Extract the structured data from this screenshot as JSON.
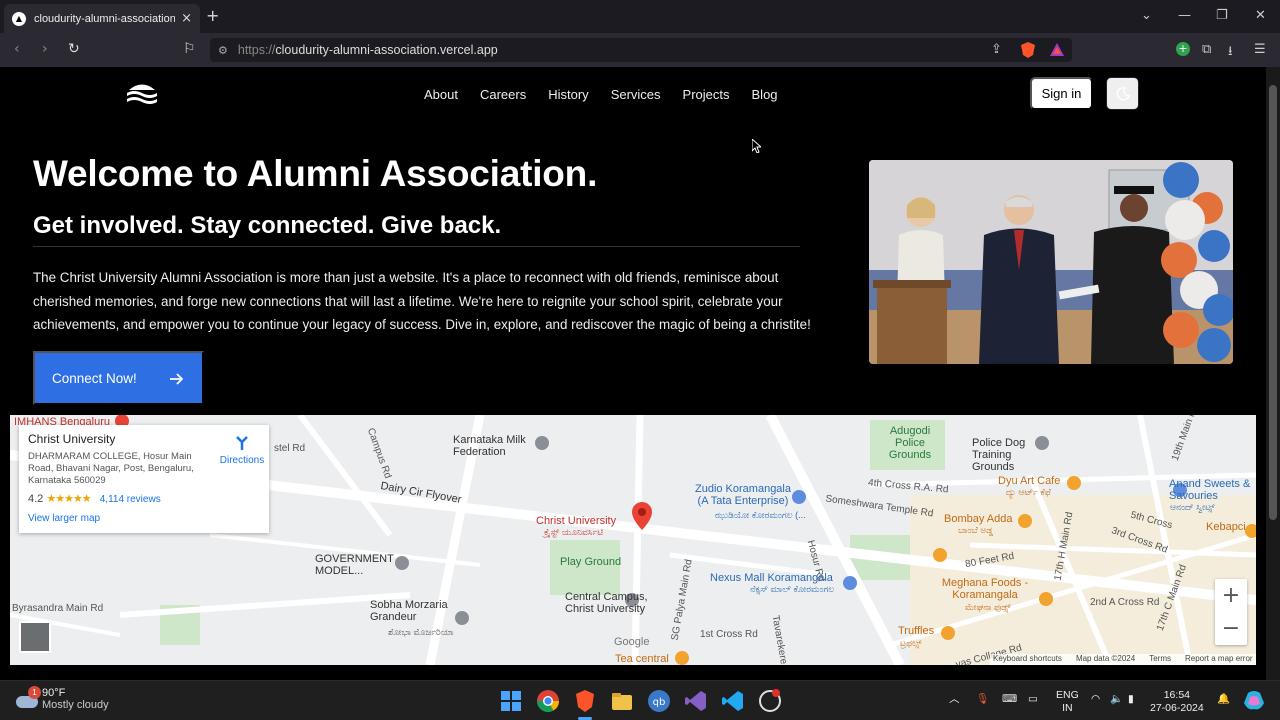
{
  "browser": {
    "tab_title": "cloudurity-alumni-association.vercel.app",
    "url_protocol": "https://",
    "url_host": "cloudurity-alumni-association.vercel.app"
  },
  "nav": {
    "items": [
      "About",
      "Careers",
      "History",
      "Services",
      "Projects",
      "Blog"
    ],
    "signin_label": "Sign in"
  },
  "hero": {
    "title": "Welcome to Alumni Association.",
    "subtitle": "Get involved. Stay connected. Give back.",
    "body": "The Christ University Alumni Association is more than just a website. It's a place to reconnect with old friends, reminisce about cherished memories, and forge new connections that will last a lifetime. We're here to reignite your school spirit, celebrate your achievements, and empower you to continue your legacy of success. Dive in, explore, and rediscover the magic of being a christite!",
    "cta_label": "Connect Now!"
  },
  "map": {
    "place_name": "Christ University",
    "address": "DHARMARAM COLLEGE, Hosur Main Road, Bhavani Nagar, Post, Bengaluru, Karnataka 560029",
    "rating": "4.2",
    "stars": "★★★★★",
    "reviews": "4,114 reviews",
    "directions": "Directions",
    "view_larger": "View larger map",
    "labels": {
      "nimhans": "IMHANS Bengaluru",
      "campus_rd": "Campus Rd",
      "castle_rd": "stel Rd",
      "karnataka_milk": "Karnataka Milk Federation",
      "adugodi": "Adugodi Police Grounds",
      "police_dog": "Police Dog Training Grounds",
      "dairy_flyover": "Dairy Cir Flyover",
      "zudio": "Zudio Koramangala (A Tata Enterprise)",
      "zudio_local": "ಝುಡಿಯೋ ಕೋರಮಂಗಲ (...",
      "christ_pin": "Christ University",
      "christ_pin_local": "ಕ್ರೈಸ್ಟ್ ಯೂನಿವರ್ಸಿಟಿ",
      "hosur_rd": "Hosur Rd",
      "cross_4th": "4th Cross R.A. Rd",
      "someshwara": "Someshwara Temple Rd",
      "dyu_art": "Dyu Art Cafe",
      "dyu_art_local": "ದ್ಯು ಆರ್ಟ್ ಕೆಫೆ",
      "anand": "Anand Sweets & Savouries",
      "anand_local": "ಆನಂದ್ ಸ್ವೀಟ್ಸ್",
      "main_19th": "19th Main Rd",
      "cross_5th": "5th Cross",
      "cross_3rd": "3rd Cross Rd",
      "kebapci": "Kebapci",
      "bombay_adda": "Bombay Adda",
      "bombay_local": "ಬಾಂಬೆ ಅಡ್ಡ",
      "feet_80": "80 Feet Rd",
      "gov_model": "GOVERNMENT MODEL...",
      "play_ground": "Play Ground",
      "nexus": "Nexus Mall Koramangala",
      "nexus_local": "ನೆಕ್ಸಸ್ ಮಾಲ್ ಕೋರಮಂಗಲ",
      "meghana": "Meghana Foods - Koramangala",
      "meghana_local": "ಮೇಘನಾ ಫುಡ್ಸ್",
      "main_17th": "17th H Main Rd",
      "main_17c": "17th C Main Rd",
      "cross_2nd": "2nd A Cross Rd",
      "central_campus": "Central Campus, Christ University",
      "sg_palya": "SG Palya Main Rd",
      "byrasandra": "Byrasandra Main Rd",
      "sobha": "Sobha Morzaria Grandeur",
      "sobha_local": "ಶೋಭಾ ಮೊರ್ಜರಿಯಾ",
      "cross_1st": "1st Cross Rd",
      "tavarekere": "Tavarekere",
      "truffles": "Truffles",
      "truffles_local": "ಟ್ರಫಲ್ಸ್",
      "tea_central": "Tea central",
      "vas_college": "vas College Rd",
      "google": "Google"
    },
    "zoom_in": "+",
    "zoom_out": "−",
    "attribution": [
      "Keyboard shortcuts",
      "Map data ©2024",
      "Terms",
      "Report a map error"
    ]
  },
  "taskbar": {
    "temp": "90°F",
    "condition": "Mostly cloudy",
    "weather_badge": "1",
    "lang1": "ENG",
    "lang2": "IN",
    "time": "16:54",
    "date": "27-06-2024"
  },
  "colors": {
    "cta": "#2f6fe4",
    "map_bg": "#eceeef",
    "pin": "#ea4335",
    "link": "#1a73e8"
  }
}
